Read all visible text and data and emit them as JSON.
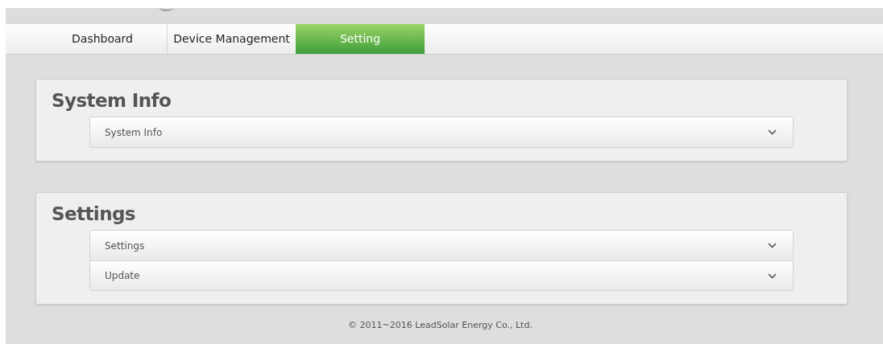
{
  "tabs": [
    {
      "label": "Dashboard",
      "selected": false
    },
    {
      "label": "Device Management",
      "selected": false
    },
    {
      "label": "Setting",
      "selected": true
    }
  ],
  "panels": [
    {
      "title": "System Info",
      "items": [
        {
          "label": "System Info",
          "expanded": false
        }
      ]
    },
    {
      "title": "Settings",
      "items": [
        {
          "label": "Settings",
          "expanded": false
        },
        {
          "label": "Update",
          "expanded": false
        }
      ]
    }
  ],
  "footer": "© 2011~2016 LeadSolar Energy Co., Ltd."
}
